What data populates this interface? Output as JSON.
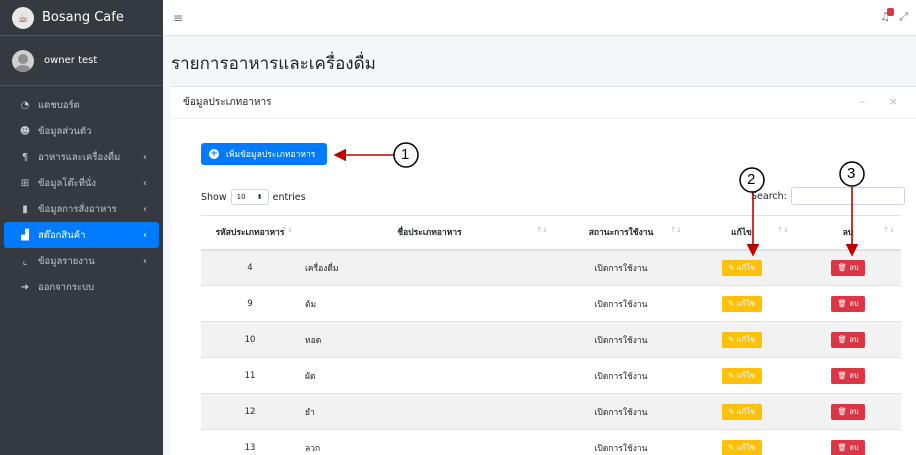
{
  "sidebar": {
    "brand": "Bosang Cafe",
    "user": "owner test",
    "items": [
      {
        "label": "แดชบอร์ด",
        "icon": "dashboard-icon",
        "glyph": "◔",
        "chev": ""
      },
      {
        "label": "ข้อมูลส่วนตัว",
        "icon": "user-icon",
        "glyph": "☻",
        "chev": ""
      },
      {
        "label": "อาหารและเครื่องดื่ม",
        "icon": "utensils-icon",
        "glyph": "¶",
        "chev": "‹"
      },
      {
        "label": "ข้อมูลโต๊ะที่นั่ง",
        "icon": "table-grid-icon",
        "glyph": "⊞",
        "chev": "‹"
      },
      {
        "label": "ข้อมูลการสั่งอาหาร",
        "icon": "clipboard-icon",
        "glyph": "▮",
        "chev": "‹"
      },
      {
        "label": "สต๊อกสินค้า",
        "icon": "boxes-icon",
        "glyph": "▟",
        "chev": "‹",
        "active": true
      },
      {
        "label": "ข้อมูลรายงาน",
        "icon": "chart-icon",
        "glyph": "⌞",
        "chev": "‹"
      },
      {
        "label": "ออกจากระบบ",
        "icon": "logout-icon",
        "glyph": "➜",
        "chev": ""
      }
    ]
  },
  "topbar": {
    "menu_icon": "≡",
    "bell_icon": "♫",
    "expand_icon": "⤢"
  },
  "page": {
    "title": "รายการอาหารและเครื่องดื่ม"
  },
  "card": {
    "title": "ข้อมูลประเภทอาหาร",
    "tools": "– ×"
  },
  "add_button": {
    "label": "เพิ่มข้อมูลประเภทอาหาร",
    "plus": "+"
  },
  "show": {
    "prefix": "Show",
    "value": "10",
    "arrows": "⬍",
    "suffix": "entries"
  },
  "search": {
    "label": "Search:"
  },
  "table": {
    "sort_glyph": "↑↓",
    "headers": [
      "รหัสประเภทอาหาร",
      "ชื่อประเภทอาหาร",
      "สถานะการใช้งาน",
      "แก้ไข",
      "ลบ"
    ],
    "rows": [
      {
        "id": "4",
        "name": "เครื่องดื่ม",
        "status": "เปิดการใช้งาน"
      },
      {
        "id": "9",
        "name": "ต้ม",
        "status": "เปิดการใช้งาน"
      },
      {
        "id": "10",
        "name": "ทอด",
        "status": "เปิดการใช้งาน"
      },
      {
        "id": "11",
        "name": "ผัด",
        "status": "เปิดการใช้งาน"
      },
      {
        "id": "12",
        "name": "ยำ",
        "status": "เปิดการใช้งาน"
      },
      {
        "id": "13",
        "name": "ลวก",
        "status": "เปิดการใช้งาน"
      }
    ],
    "edit_label": "แก้ไข",
    "edit_icon": "✎",
    "delete_label": "ลบ",
    "delete_icon": "🗑"
  },
  "annotations": [
    "1",
    "2",
    "3"
  ],
  "colors": {
    "sidebar": "#343a40",
    "primary": "#007bff",
    "warning": "#ffc107",
    "danger": "#dc3545",
    "annotation": "#c00000"
  }
}
